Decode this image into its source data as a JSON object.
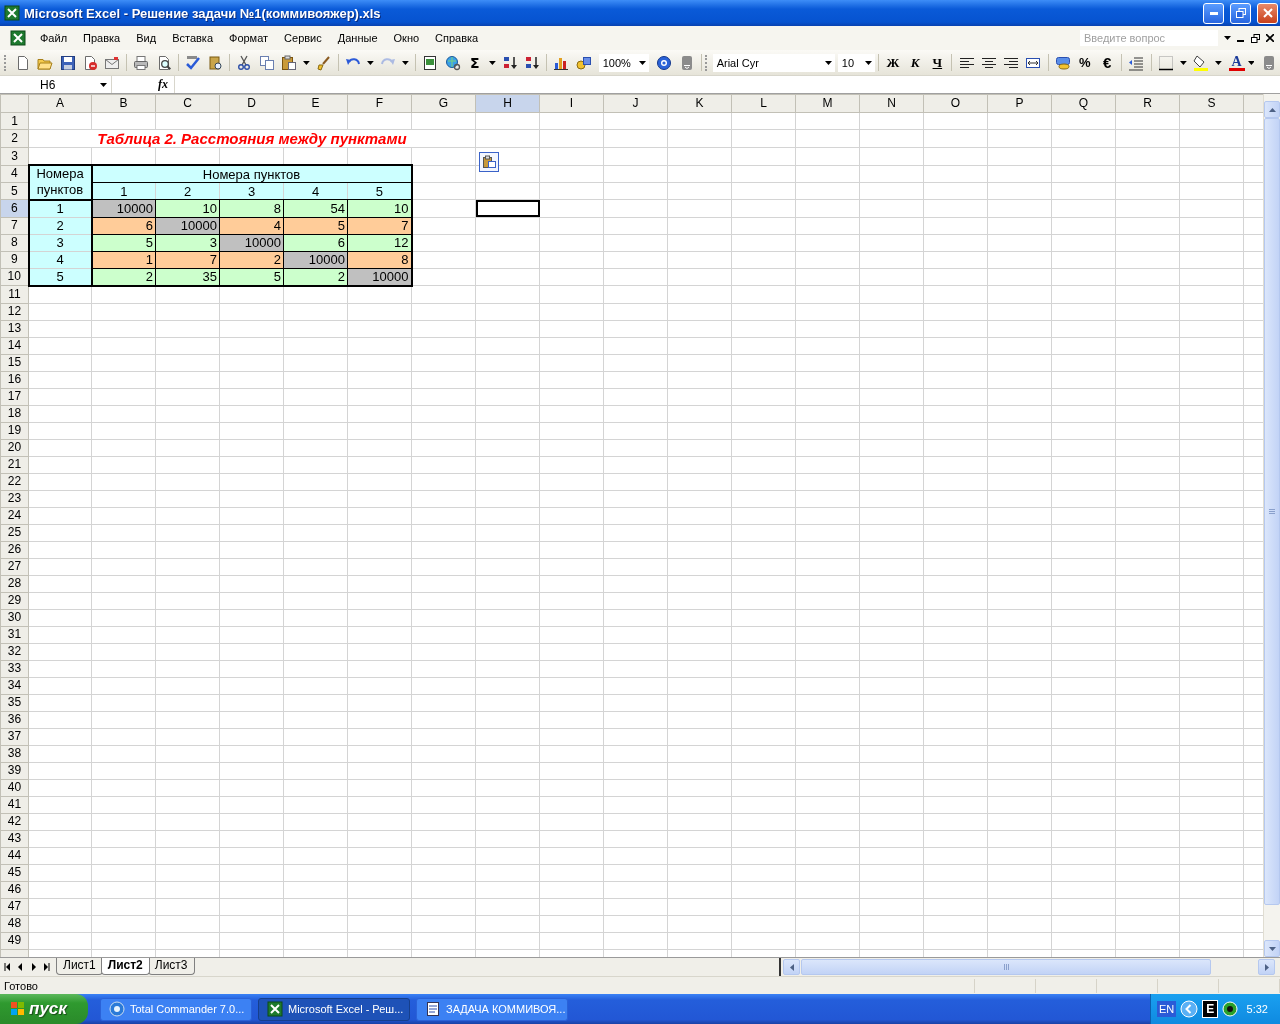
{
  "window": {
    "title": "Microsoft Excel - Решение задачи №1(коммивояжер).xls"
  },
  "menu": {
    "items": [
      "Файл",
      "Правка",
      "Вид",
      "Вставка",
      "Формат",
      "Сервис",
      "Данные",
      "Окно",
      "Справка"
    ],
    "ask_placeholder": "Введите вопрос"
  },
  "toolbar": {
    "sum": "Σ",
    "zoom": "100%",
    "font": "Arial Cyr",
    "size": "10",
    "bold": "Ж",
    "italic": "К",
    "underline": "Ч",
    "percent": "%",
    "euro": "€",
    "font_color": "A",
    "redo_disabled": true
  },
  "formula_bar": {
    "name_box": "H6",
    "fx": "fx"
  },
  "sheet": {
    "columns": [
      {
        "label": "A",
        "selected": false
      },
      {
        "label": "B",
        "selected": false
      },
      {
        "label": "C",
        "selected": false
      },
      {
        "label": "D",
        "selected": false
      },
      {
        "label": "E",
        "selected": false
      },
      {
        "label": "F",
        "selected": false
      },
      {
        "label": "G",
        "selected": false
      },
      {
        "label": "H",
        "selected": true
      },
      {
        "label": "I",
        "selected": false
      },
      {
        "label": "J",
        "selected": false
      },
      {
        "label": "K",
        "selected": false
      },
      {
        "label": "L",
        "selected": false
      },
      {
        "label": "M",
        "selected": false
      },
      {
        "label": "N",
        "selected": false
      },
      {
        "label": "O",
        "selected": false
      },
      {
        "label": "P",
        "selected": false
      },
      {
        "label": "Q",
        "selected": false
      },
      {
        "label": "R",
        "selected": false
      },
      {
        "label": "S",
        "selected": false
      }
    ],
    "rows": [
      {
        "label": "1",
        "selected": false
      },
      {
        "label": "2",
        "selected": false
      },
      {
        "label": "3",
        "selected": false
      },
      {
        "label": "4",
        "selected": false
      },
      {
        "label": "5",
        "selected": false
      },
      {
        "label": "6",
        "selected": true
      },
      {
        "label": "7",
        "selected": false
      },
      {
        "label": "8",
        "selected": false
      },
      {
        "label": "9",
        "selected": false
      },
      {
        "label": "10",
        "selected": false
      },
      {
        "label": "11",
        "selected": false
      },
      {
        "label": "12",
        "selected": false
      },
      {
        "label": "13",
        "selected": false
      },
      {
        "label": "14",
        "selected": false
      },
      {
        "label": "15",
        "selected": false
      },
      {
        "label": "16",
        "selected": false
      },
      {
        "label": "17",
        "selected": false
      },
      {
        "label": "18",
        "selected": false
      },
      {
        "label": "19",
        "selected": false
      },
      {
        "label": "20",
        "selected": false
      },
      {
        "label": "21",
        "selected": false
      },
      {
        "label": "22",
        "selected": false
      },
      {
        "label": "23",
        "selected": false
      },
      {
        "label": "24",
        "selected": false
      },
      {
        "label": "25",
        "selected": false
      },
      {
        "label": "26",
        "selected": false
      },
      {
        "label": "27",
        "selected": false
      },
      {
        "label": "28",
        "selected": false
      },
      {
        "label": "29",
        "selected": false
      },
      {
        "label": "30",
        "selected": false
      },
      {
        "label": "31",
        "selected": false
      },
      {
        "label": "32",
        "selected": false
      },
      {
        "label": "33",
        "selected": false
      },
      {
        "label": "34",
        "selected": false
      },
      {
        "label": "35",
        "selected": false
      },
      {
        "label": "36",
        "selected": false
      },
      {
        "label": "37",
        "selected": false
      },
      {
        "label": "38",
        "selected": false
      },
      {
        "label": "39",
        "selected": false
      },
      {
        "label": "40",
        "selected": false
      },
      {
        "label": "41",
        "selected": false
      },
      {
        "label": "42",
        "selected": false
      },
      {
        "label": "43",
        "selected": false
      },
      {
        "label": "44",
        "selected": false
      },
      {
        "label": "45",
        "selected": false
      },
      {
        "label": "46",
        "selected": false
      },
      {
        "label": "47",
        "selected": false
      },
      {
        "label": "48",
        "selected": false
      },
      {
        "label": "49",
        "selected": false
      }
    ],
    "title": "Таблица 2. Расстояния между пунктами",
    "table": {
      "corner": "Номера пунктов",
      "header": "Номера пунктов",
      "col_labels": [
        "1",
        "2",
        "3",
        "4",
        "5"
      ],
      "rows": [
        {
          "label": "1",
          "cells": [
            {
              "value": "10000",
              "color": "#c0c0c0"
            },
            {
              "value": "10",
              "color": "#ccffcc"
            },
            {
              "value": "8",
              "color": "#ccffcc"
            },
            {
              "value": "54",
              "color": "#ccffcc"
            },
            {
              "value": "10",
              "color": "#ccffcc"
            }
          ]
        },
        {
          "label": "2",
          "cells": [
            {
              "value": "6",
              "color": "#ffcc99"
            },
            {
              "value": "10000",
              "color": "#c0c0c0"
            },
            {
              "value": "4",
              "color": "#ffcc99"
            },
            {
              "value": "5",
              "color": "#ffcc99"
            },
            {
              "value": "7",
              "color": "#ffcc99"
            }
          ]
        },
        {
          "label": "3",
          "cells": [
            {
              "value": "5",
              "color": "#ccffcc"
            },
            {
              "value": "3",
              "color": "#ccffcc"
            },
            {
              "value": "10000",
              "color": "#c0c0c0"
            },
            {
              "value": "6",
              "color": "#ccffcc"
            },
            {
              "value": "12",
              "color": "#ccffcc"
            }
          ]
        },
        {
          "label": "4",
          "cells": [
            {
              "value": "1",
              "color": "#ffcc99"
            },
            {
              "value": "7",
              "color": "#ffcc99"
            },
            {
              "value": "2",
              "color": "#ffcc99"
            },
            {
              "value": "10000",
              "color": "#c0c0c0"
            },
            {
              "value": "8",
              "color": "#ffcc99"
            }
          ]
        },
        {
          "label": "5",
          "cells": [
            {
              "value": "2",
              "color": "#ccffcc"
            },
            {
              "value": "35",
              "color": "#ccffcc"
            },
            {
              "value": "5",
              "color": "#ccffcc"
            },
            {
              "value": "2",
              "color": "#ccffcc"
            },
            {
              "value": "10000",
              "color": "#c0c0c0"
            }
          ]
        }
      ]
    }
  },
  "sheet_tabs": [
    {
      "label": "Лист1",
      "selected": false
    },
    {
      "label": "Лист2",
      "selected": true
    },
    {
      "label": "Лист3",
      "selected": false
    }
  ],
  "status_bar": {
    "text": "Готово"
  },
  "taskbar": {
    "start": "пуск",
    "tasks": [
      {
        "label": "Total Commander 7.0...",
        "selected": false
      },
      {
        "label": "Microsoft Excel - Реш...",
        "selected": true
      },
      {
        "label": "ЗАДАЧА КОММИВОЯ...",
        "selected": false
      }
    ],
    "tray": {
      "language": "EN",
      "badge": "E",
      "clock": "5:32"
    }
  }
}
